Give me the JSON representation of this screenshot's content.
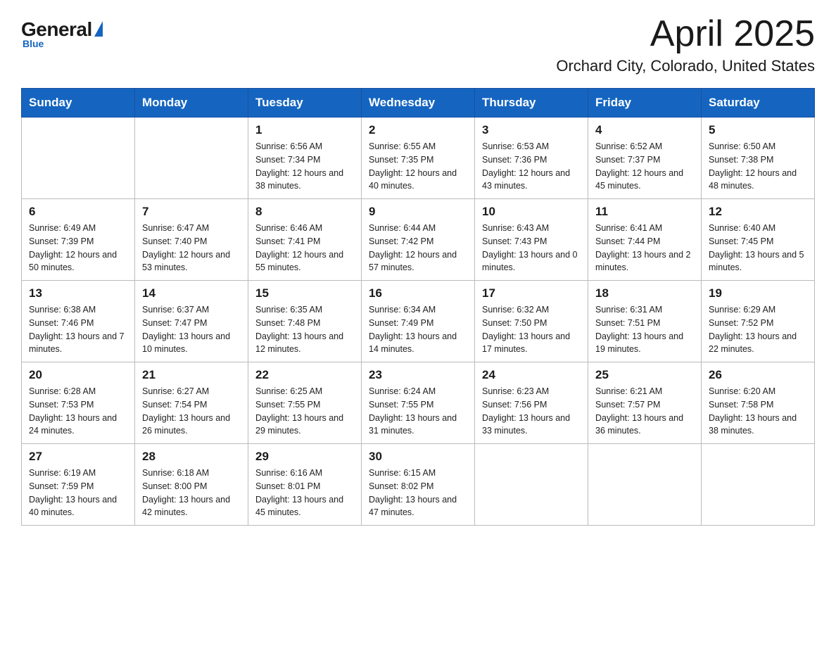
{
  "logo": {
    "general": "General",
    "blue": "Blue",
    "underline": "Blue"
  },
  "header": {
    "month": "April 2025",
    "location": "Orchard City, Colorado, United States"
  },
  "weekdays": [
    "Sunday",
    "Monday",
    "Tuesday",
    "Wednesday",
    "Thursday",
    "Friday",
    "Saturday"
  ],
  "weeks": [
    [
      {
        "day": "",
        "sunrise": "",
        "sunset": "",
        "daylight": ""
      },
      {
        "day": "",
        "sunrise": "",
        "sunset": "",
        "daylight": ""
      },
      {
        "day": "1",
        "sunrise": "Sunrise: 6:56 AM",
        "sunset": "Sunset: 7:34 PM",
        "daylight": "Daylight: 12 hours and 38 minutes."
      },
      {
        "day": "2",
        "sunrise": "Sunrise: 6:55 AM",
        "sunset": "Sunset: 7:35 PM",
        "daylight": "Daylight: 12 hours and 40 minutes."
      },
      {
        "day": "3",
        "sunrise": "Sunrise: 6:53 AM",
        "sunset": "Sunset: 7:36 PM",
        "daylight": "Daylight: 12 hours and 43 minutes."
      },
      {
        "day": "4",
        "sunrise": "Sunrise: 6:52 AM",
        "sunset": "Sunset: 7:37 PM",
        "daylight": "Daylight: 12 hours and 45 minutes."
      },
      {
        "day": "5",
        "sunrise": "Sunrise: 6:50 AM",
        "sunset": "Sunset: 7:38 PM",
        "daylight": "Daylight: 12 hours and 48 minutes."
      }
    ],
    [
      {
        "day": "6",
        "sunrise": "Sunrise: 6:49 AM",
        "sunset": "Sunset: 7:39 PM",
        "daylight": "Daylight: 12 hours and 50 minutes."
      },
      {
        "day": "7",
        "sunrise": "Sunrise: 6:47 AM",
        "sunset": "Sunset: 7:40 PM",
        "daylight": "Daylight: 12 hours and 53 minutes."
      },
      {
        "day": "8",
        "sunrise": "Sunrise: 6:46 AM",
        "sunset": "Sunset: 7:41 PM",
        "daylight": "Daylight: 12 hours and 55 minutes."
      },
      {
        "day": "9",
        "sunrise": "Sunrise: 6:44 AM",
        "sunset": "Sunset: 7:42 PM",
        "daylight": "Daylight: 12 hours and 57 minutes."
      },
      {
        "day": "10",
        "sunrise": "Sunrise: 6:43 AM",
        "sunset": "Sunset: 7:43 PM",
        "daylight": "Daylight: 13 hours and 0 minutes."
      },
      {
        "day": "11",
        "sunrise": "Sunrise: 6:41 AM",
        "sunset": "Sunset: 7:44 PM",
        "daylight": "Daylight: 13 hours and 2 minutes."
      },
      {
        "day": "12",
        "sunrise": "Sunrise: 6:40 AM",
        "sunset": "Sunset: 7:45 PM",
        "daylight": "Daylight: 13 hours and 5 minutes."
      }
    ],
    [
      {
        "day": "13",
        "sunrise": "Sunrise: 6:38 AM",
        "sunset": "Sunset: 7:46 PM",
        "daylight": "Daylight: 13 hours and 7 minutes."
      },
      {
        "day": "14",
        "sunrise": "Sunrise: 6:37 AM",
        "sunset": "Sunset: 7:47 PM",
        "daylight": "Daylight: 13 hours and 10 minutes."
      },
      {
        "day": "15",
        "sunrise": "Sunrise: 6:35 AM",
        "sunset": "Sunset: 7:48 PM",
        "daylight": "Daylight: 13 hours and 12 minutes."
      },
      {
        "day": "16",
        "sunrise": "Sunrise: 6:34 AM",
        "sunset": "Sunset: 7:49 PM",
        "daylight": "Daylight: 13 hours and 14 minutes."
      },
      {
        "day": "17",
        "sunrise": "Sunrise: 6:32 AM",
        "sunset": "Sunset: 7:50 PM",
        "daylight": "Daylight: 13 hours and 17 minutes."
      },
      {
        "day": "18",
        "sunrise": "Sunrise: 6:31 AM",
        "sunset": "Sunset: 7:51 PM",
        "daylight": "Daylight: 13 hours and 19 minutes."
      },
      {
        "day": "19",
        "sunrise": "Sunrise: 6:29 AM",
        "sunset": "Sunset: 7:52 PM",
        "daylight": "Daylight: 13 hours and 22 minutes."
      }
    ],
    [
      {
        "day": "20",
        "sunrise": "Sunrise: 6:28 AM",
        "sunset": "Sunset: 7:53 PM",
        "daylight": "Daylight: 13 hours and 24 minutes."
      },
      {
        "day": "21",
        "sunrise": "Sunrise: 6:27 AM",
        "sunset": "Sunset: 7:54 PM",
        "daylight": "Daylight: 13 hours and 26 minutes."
      },
      {
        "day": "22",
        "sunrise": "Sunrise: 6:25 AM",
        "sunset": "Sunset: 7:55 PM",
        "daylight": "Daylight: 13 hours and 29 minutes."
      },
      {
        "day": "23",
        "sunrise": "Sunrise: 6:24 AM",
        "sunset": "Sunset: 7:55 PM",
        "daylight": "Daylight: 13 hours and 31 minutes."
      },
      {
        "day": "24",
        "sunrise": "Sunrise: 6:23 AM",
        "sunset": "Sunset: 7:56 PM",
        "daylight": "Daylight: 13 hours and 33 minutes."
      },
      {
        "day": "25",
        "sunrise": "Sunrise: 6:21 AM",
        "sunset": "Sunset: 7:57 PM",
        "daylight": "Daylight: 13 hours and 36 minutes."
      },
      {
        "day": "26",
        "sunrise": "Sunrise: 6:20 AM",
        "sunset": "Sunset: 7:58 PM",
        "daylight": "Daylight: 13 hours and 38 minutes."
      }
    ],
    [
      {
        "day": "27",
        "sunrise": "Sunrise: 6:19 AM",
        "sunset": "Sunset: 7:59 PM",
        "daylight": "Daylight: 13 hours and 40 minutes."
      },
      {
        "day": "28",
        "sunrise": "Sunrise: 6:18 AM",
        "sunset": "Sunset: 8:00 PM",
        "daylight": "Daylight: 13 hours and 42 minutes."
      },
      {
        "day": "29",
        "sunrise": "Sunrise: 6:16 AM",
        "sunset": "Sunset: 8:01 PM",
        "daylight": "Daylight: 13 hours and 45 minutes."
      },
      {
        "day": "30",
        "sunrise": "Sunrise: 6:15 AM",
        "sunset": "Sunset: 8:02 PM",
        "daylight": "Daylight: 13 hours and 47 minutes."
      },
      {
        "day": "",
        "sunrise": "",
        "sunset": "",
        "daylight": ""
      },
      {
        "day": "",
        "sunrise": "",
        "sunset": "",
        "daylight": ""
      },
      {
        "day": "",
        "sunrise": "",
        "sunset": "",
        "daylight": ""
      }
    ]
  ]
}
